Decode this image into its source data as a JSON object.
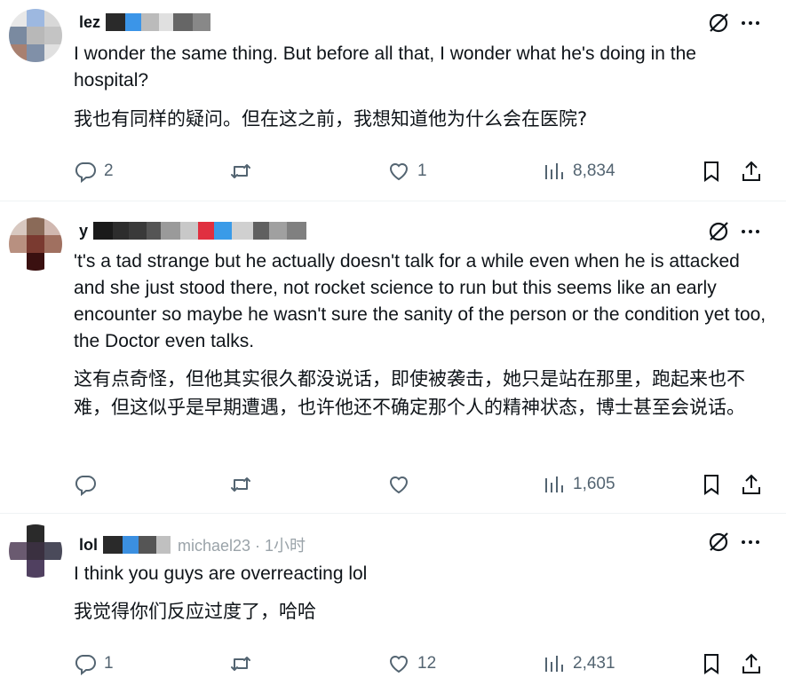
{
  "tweets": [
    {
      "handle_fragment": "lez",
      "text_en": "I wonder the same thing. But before all that, I wonder what he's doing in the hospital?",
      "text_zh": "我也有同样的疑问。但在这之前，我想知道他为什么会在医院?",
      "replies": "2",
      "retweets": "",
      "likes": "1",
      "views": "8,834",
      "avatar_colors": [
        "#e8e8e8",
        "#9db8e0",
        "#d8d8d8",
        "#7a8aa0",
        "#b8b8b8",
        "#c4c4c4",
        "#a88070",
        "#8090a8",
        "#e0e0e0"
      ],
      "header_blocks": [
        "#2a2a2a",
        "#3b95e8",
        "#bbbbbb",
        "#e0e0e0",
        "#666666",
        "#888888"
      ]
    },
    {
      "handle_fragment": "y",
      "text_en": "'t's a tad strange but he actually doesn't talk for a while even when he is attacked and she just stood there, not rocket science to run but this seems like an early encounter so maybe he wasn't sure the sanity of the person or the condition yet too, the Doctor even talks.",
      "text_zh": "这有点奇怪，但他其实很久都没说话，即使被袭击，她只是站在那里，跑起来也不难，但这似乎是早期遭遇，也许他还不确定那个人的精神状态，博士甚至会说话。",
      "replies": "",
      "retweets": "",
      "likes": "",
      "views": "1,605",
      "avatar_colors": [
        "#d8c8c0",
        "#8a6a58",
        "#d0b8b0",
        "#b89080",
        "#7a3a30",
        "#a07060",
        "#ffffff",
        "#3a1010",
        "#ffffff"
      ],
      "header_blocks": [
        "#1a1a1a",
        "#2d2d2d",
        "#3a3a3a",
        "#555555",
        "#9a9a9a",
        "#c8c8c8",
        "#e03040",
        "#3a9be8",
        "#d0d0d0",
        "#606060",
        "#a0a0a0",
        "#808080"
      ]
    },
    {
      "handle_fragment": "lol",
      "handle_tail": "michael23 · 1小时",
      "text_en": "I think you guys are overreacting lol",
      "text_zh": "我觉得你们反应过度了，哈哈",
      "replies": "1",
      "retweets": "",
      "likes": "12",
      "views": "2,431",
      "avatar_colors": [
        "#ffffff",
        "#2a2a2a",
        "#ffffff",
        "#6a5a70",
        "#3a3040",
        "#4a4a5a",
        "#ffffff",
        "#504060",
        "#ffffff"
      ],
      "header_blocks": [
        "#2a2a2a",
        "#3b8fe0",
        "#555555",
        "#c0c0c0"
      ]
    }
  ],
  "colors": {
    "icon_gray": "#536471",
    "text": "#0f1419",
    "divider": "#eff3f4"
  },
  "icons": [
    "reply-icon",
    "retweet-icon",
    "like-icon",
    "views-icon",
    "bookmark-icon",
    "share-icon",
    "grok-icon",
    "more-icon"
  ]
}
